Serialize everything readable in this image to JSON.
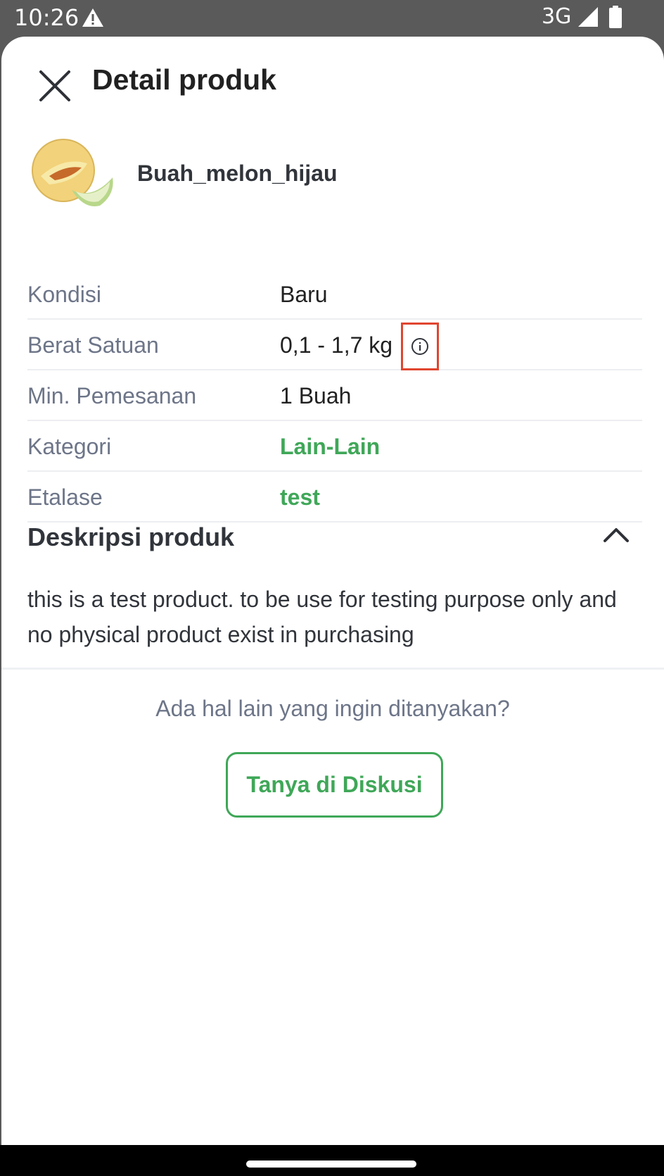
{
  "status_bar": {
    "time": "10:26",
    "network": "3G",
    "icons": [
      "warning-icon",
      "signal-icon",
      "battery-icon"
    ]
  },
  "header": {
    "title": "Detail produk",
    "close_icon": "close-icon"
  },
  "product": {
    "name": "Buah_melon_hijau",
    "image": "melon-image"
  },
  "info_rows": [
    {
      "label": "Kondisi",
      "value": "Baru"
    },
    {
      "label": "Berat Satuan",
      "value": "0,1 - 1,7 kg",
      "icon": "info-icon"
    },
    {
      "label": "Min. Pemesanan",
      "value": "1 Buah"
    },
    {
      "label": "Kategori",
      "value": "Lain-Lain"
    },
    {
      "label": "Etalase",
      "value": "test"
    }
  ],
  "description": {
    "title": "Deskripsi produk",
    "toggle_icon": "chevron-up-icon",
    "text": "this is a test product. to be use for testing purpose only and no physical product exist in purchasing"
  },
  "discussion": {
    "question": "Ada hal lain yang ingin ditanyakan?",
    "button_label": "Tanya di Diskusi"
  },
  "colors": {
    "accent_green": "#3fa758",
    "highlight_red": "#e0452f",
    "text_dark": "#212121",
    "text_muted": "#6d7588"
  }
}
